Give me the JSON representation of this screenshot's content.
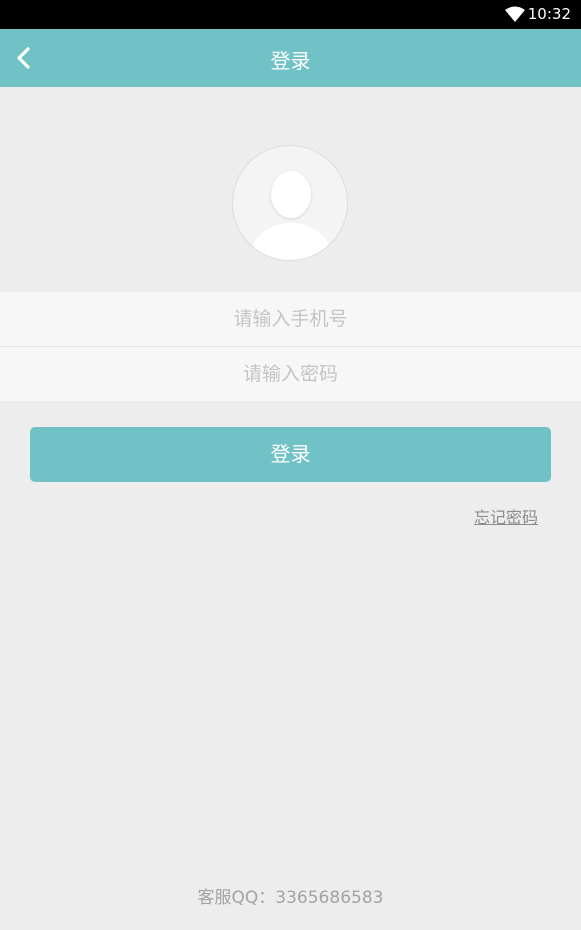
{
  "status_bar": {
    "time": "10:32",
    "icons": [
      "wifi-icon"
    ]
  },
  "header": {
    "title": "登录",
    "back_icon": "chevron-left-icon"
  },
  "avatar": {
    "icon": "user-avatar-icon"
  },
  "form": {
    "phone_placeholder": "请输入手机号",
    "phone_value": "",
    "password_placeholder": "请输入密码",
    "password_value": ""
  },
  "actions": {
    "login_label": "登录",
    "forgot_label": "忘记密码"
  },
  "footer": {
    "support_text": "客服QQ：3365686583"
  },
  "colors": {
    "accent": "#70c2c6",
    "background": "#ededed",
    "input_background": "#f7f7f7",
    "status_bar": "#000000"
  }
}
